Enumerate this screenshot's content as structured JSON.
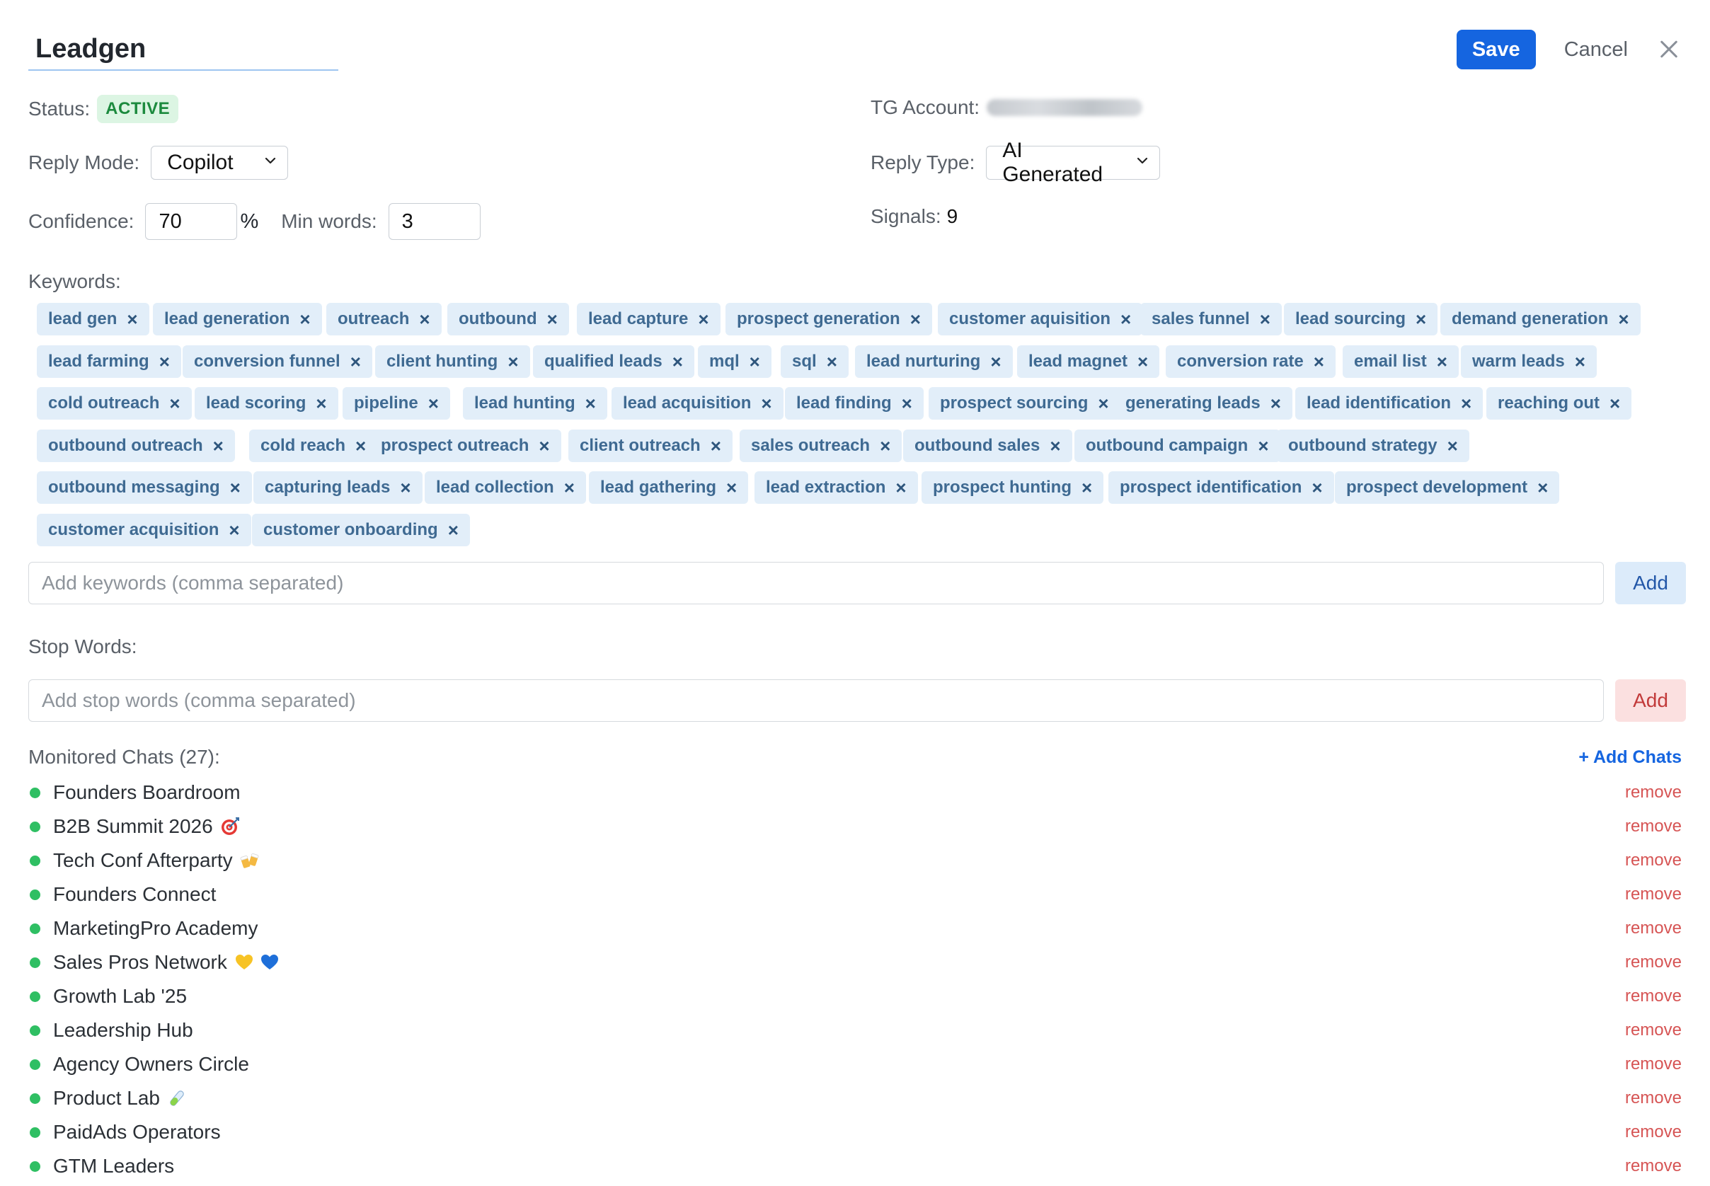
{
  "header": {
    "title_value": "Leadgen",
    "save_label": "Save",
    "cancel_label": "Cancel"
  },
  "fields": {
    "status_label": "Status:",
    "status_value": "ACTIVE",
    "tg_account_label": "TG Account:",
    "reply_mode_label": "Reply Mode:",
    "reply_mode_value": "Copilot",
    "reply_type_label": "Reply Type:",
    "reply_type_value": "AI Generated",
    "confidence_label": "Confidence:",
    "confidence_value": "70",
    "confidence_unit": "%",
    "min_words_label": "Min words:",
    "min_words_value": "3",
    "signals_label": "Signals:",
    "signals_value": "9"
  },
  "keywords": {
    "label": "Keywords:",
    "remove_glyph": "×",
    "rows": [
      [
        "lead gen",
        "lead generation",
        "outreach",
        "outbound",
        "lead capture",
        "prospect generation",
        "customer aquisition",
        "sales funnel",
        "lead sourcing",
        "demand generation"
      ],
      [
        "lead farming",
        "conversion funnel",
        "client hunting",
        "qualified leads",
        "mql",
        "sql",
        "lead nurturing",
        "lead magnet",
        "conversion rate",
        "email list",
        "warm leads"
      ],
      [
        "cold outreach",
        "lead scoring",
        "pipeline",
        "lead hunting",
        "lead acquisition",
        "lead finding",
        "prospect sourcing",
        "generating leads",
        "lead identification",
        "reaching out"
      ],
      [
        "outbound outreach",
        "cold reach",
        "prospect outreach",
        "client outreach",
        "sales outreach",
        "outbound sales",
        "outbound campaign",
        "outbound strategy"
      ],
      [
        "outbound messaging",
        "capturing leads",
        "lead collection",
        "lead gathering",
        "lead extraction",
        "prospect hunting",
        "prospect identification",
        "prospect development"
      ],
      [
        "customer acquisition",
        "customer onboarding"
      ]
    ],
    "input_placeholder": "Add keywords (comma separated)",
    "add_label": "Add"
  },
  "stop_words": {
    "label": "Stop Words:",
    "input_placeholder": "Add stop words (comma separated)",
    "add_label": "Add"
  },
  "chats": {
    "title": "Monitored Chats (27):",
    "add_label": "+ Add Chats",
    "remove_label": "remove",
    "items": [
      {
        "name": "Founders Boardroom",
        "emoji": ""
      },
      {
        "name": "B2B Summit 2026",
        "emoji": "target-emoji"
      },
      {
        "name": "Tech Conf Afterparty",
        "emoji": "clinking-beers-emoji"
      },
      {
        "name": "Founders Connect",
        "emoji": ""
      },
      {
        "name": "MarketingPro Academy",
        "emoji": ""
      },
      {
        "name": "Sales Pros Network",
        "emoji": "yellow-heart-emoji blue-heart-emoji"
      },
      {
        "name": "Growth Lab '25",
        "emoji": ""
      },
      {
        "name": "Leadership Hub",
        "emoji": ""
      },
      {
        "name": "Agency Owners Circle",
        "emoji": ""
      },
      {
        "name": "Product Lab",
        "emoji": "test-tube-emoji"
      },
      {
        "name": "PaidAds Operators",
        "emoji": ""
      },
      {
        "name": "GTM Leaders",
        "emoji": ""
      }
    ]
  },
  "colors": {
    "accent": "#1565e0",
    "chip_bg": "#e2eef9",
    "chip_text": "#3f6a92",
    "active_bg": "#dcf5e3",
    "active_text": "#1c8a3e",
    "status_dot": "#2fbf63",
    "remove_text": "#d65454"
  }
}
